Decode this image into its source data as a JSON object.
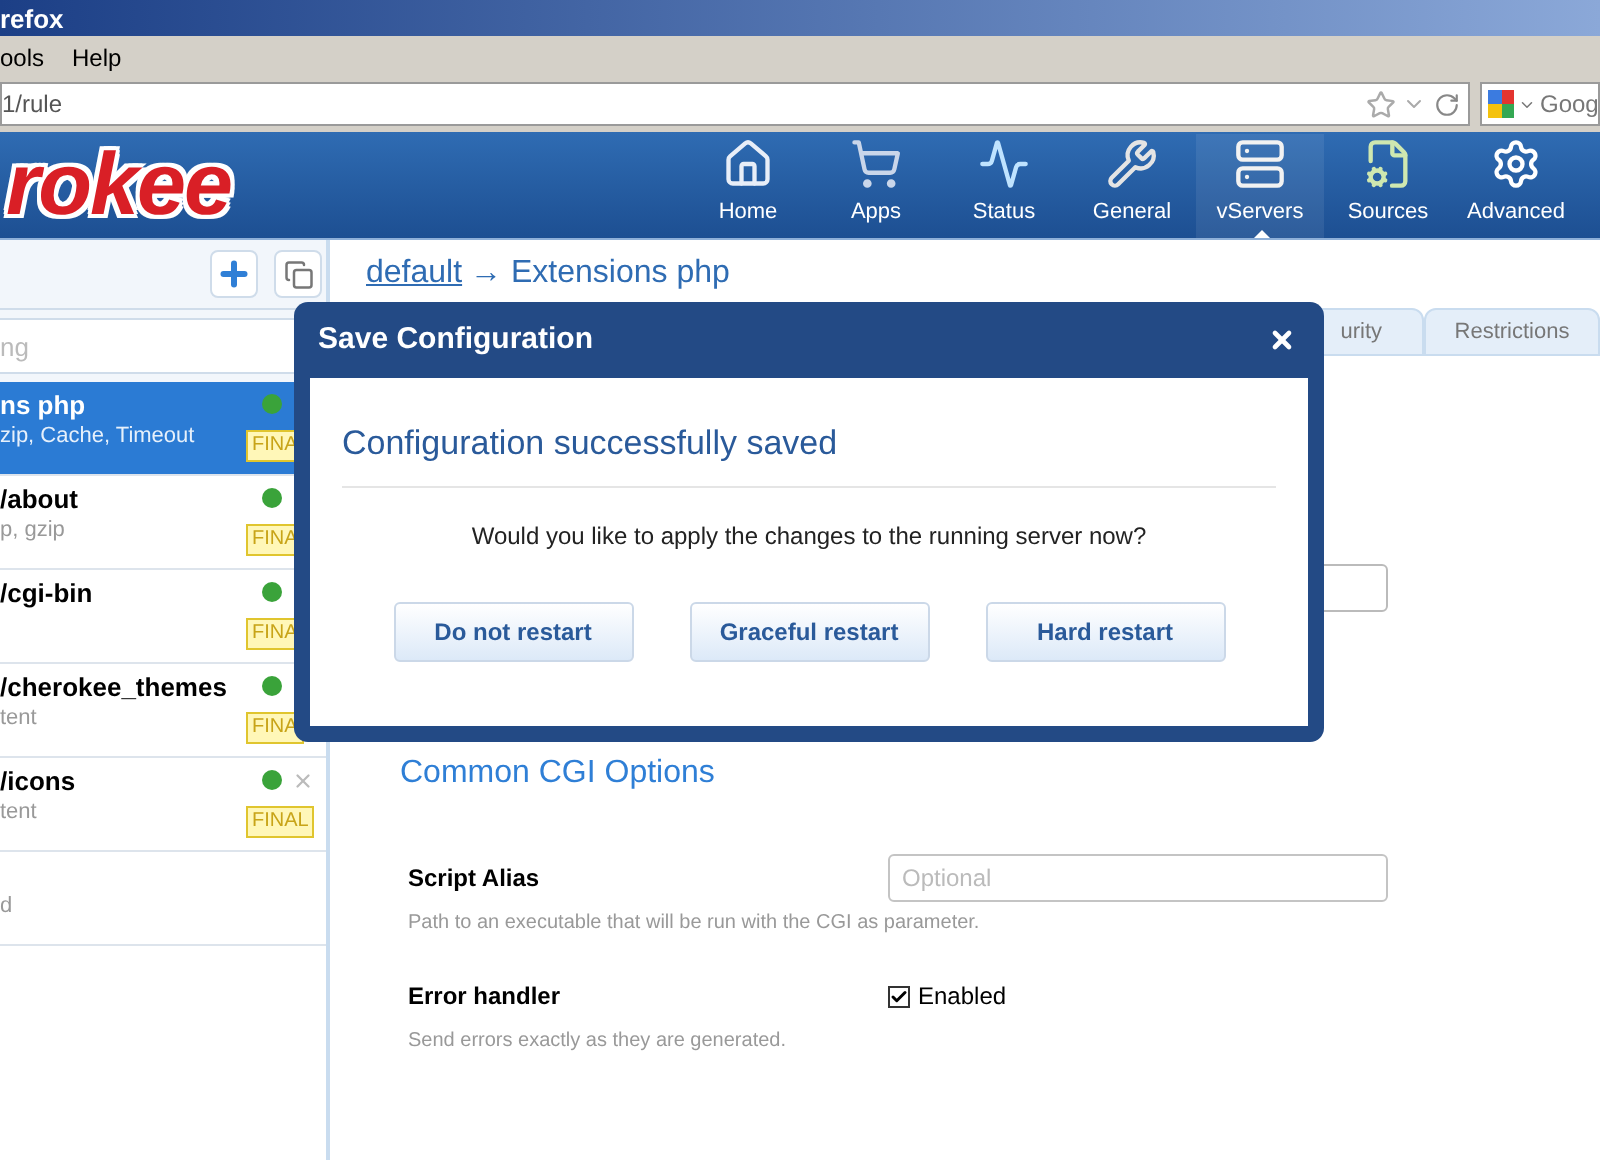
{
  "browser": {
    "title": "refox",
    "menu": [
      "ools",
      "Help"
    ],
    "url": "1/rule",
    "search_placeholder": "Goog"
  },
  "header": {
    "logo": "rokee",
    "nav": [
      {
        "label": "Home",
        "selected": false
      },
      {
        "label": "Apps",
        "selected": false
      },
      {
        "label": "Status",
        "selected": false
      },
      {
        "label": "General",
        "selected": false
      },
      {
        "label": "vServers",
        "selected": true
      },
      {
        "label": "Sources",
        "selected": false
      },
      {
        "label": "Advanced",
        "selected": false
      }
    ]
  },
  "sidebar": {
    "search": {
      "placeholder": "ng"
    },
    "rules": [
      {
        "title": "ns php",
        "subtitle": "zip, Cache, Timeout",
        "badge": "FINA",
        "selected": true,
        "active": true,
        "removable": false
      },
      {
        "title": "/about",
        "subtitle": "p, gzip",
        "badge": "FINA",
        "selected": false,
        "active": true,
        "removable": false
      },
      {
        "title": "/cgi-bin",
        "badge": "FINA",
        "selected": false,
        "active": true,
        "removable": false
      },
      {
        "title": "/cherokee_themes",
        "subtitle": "tent",
        "badge": "FINA",
        "selected": false,
        "active": true,
        "removable": false
      },
      {
        "title": "/icons",
        "subtitle": "tent",
        "badge": "FINAL",
        "selected": false,
        "active": true,
        "removable": true
      },
      {
        "subtitle": "d",
        "selected": false,
        "removable": false
      }
    ]
  },
  "main": {
    "breadcrumb": {
      "link": "default",
      "current": "→ Extensions php"
    },
    "tabs": [
      {
        "label": "urity",
        "selected": false
      },
      {
        "label": "Restrictions",
        "selected": false
      }
    ],
    "section_title": "Common CGI Options",
    "fields": [
      {
        "kind": "text",
        "label": "Script Alias",
        "placeholder": "Optional",
        "hint": "Path to an executable that will be run with the CGI as parameter."
      },
      {
        "kind": "checkbox",
        "label": "Error handler",
        "checked": true,
        "option": "Enabled",
        "hint": "Send errors exactly as they are generated."
      }
    ]
  },
  "modal": {
    "title": "Save Configuration",
    "heading": "Configuration successfully saved",
    "message": "Would you like to apply the changes to the running server now?",
    "buttons": [
      "Do not restart",
      "Graceful restart",
      "Hard restart"
    ]
  }
}
